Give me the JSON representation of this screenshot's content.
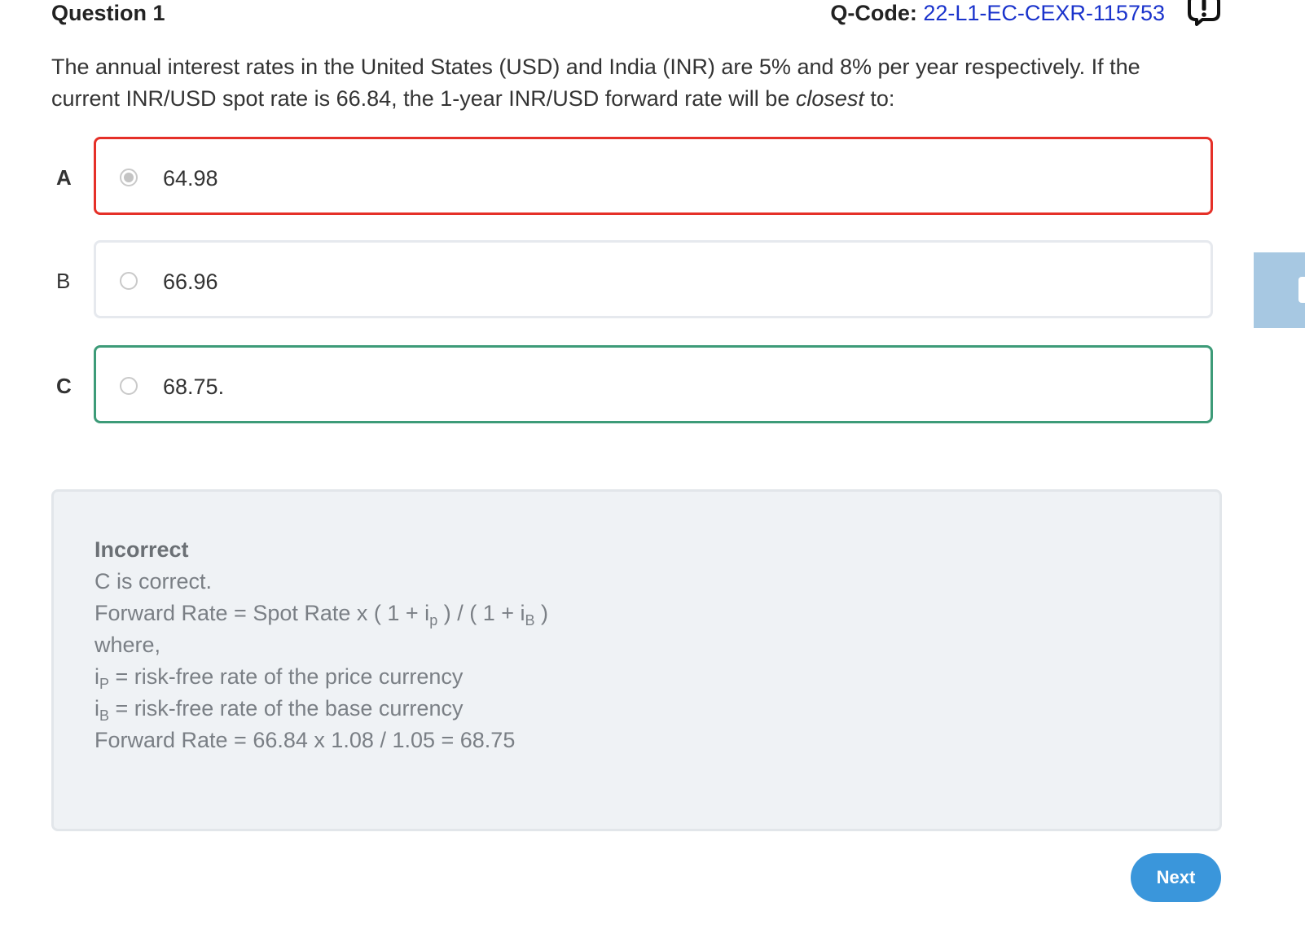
{
  "header": {
    "question_number": "Question 1",
    "qcode_label": "Q-Code:",
    "qcode_value": "22-L1-EC-CEXR-115753",
    "report_icon": "exclamation-icon"
  },
  "question": {
    "text_before": "The annual interest rates in the United States (USD) and India (INR) are 5% and 8% per year respectively. If the current INR/USD spot rate is 66.84, the 1-year INR/USD forward rate will be ",
    "text_emphasis": "closest",
    "text_after": " to:"
  },
  "options": [
    {
      "letter": "A",
      "text": "64.98",
      "selected": true,
      "state": "incorrect"
    },
    {
      "letter": "B",
      "text": "66.96",
      "selected": false,
      "state": "neutral"
    },
    {
      "letter": "C",
      "text": "68.75.",
      "selected": false,
      "state": "correct"
    }
  ],
  "explanation": {
    "status": "Incorrect",
    "correct_line": "C is correct.",
    "formula_prefix": "Forward Rate = Spot Rate x ( 1 + i",
    "formula_sub_p": "p",
    "formula_middle": " ) / ( 1 + i",
    "formula_sub_b": "B",
    "formula_suffix": " )",
    "where": "where,",
    "ip_prefix": "i",
    "ip_sub": "P",
    "ip_def": " = risk-free rate of the price currency",
    "ib_prefix": "i",
    "ib_sub": "B",
    "ib_def": " = risk-free rate of the base currency",
    "calculation": "Forward Rate = 66.84 x 1.08 / 1.05 = 68.75"
  },
  "colors": {
    "incorrect_border": "#e53028",
    "correct_border": "#3d9b78",
    "neutral_border": "#e6e9ee",
    "link_blue": "#1a33cc",
    "next_button": "#3a96db",
    "explanation_bg": "#eff2f5"
  },
  "next_button": {
    "label": "Next"
  }
}
